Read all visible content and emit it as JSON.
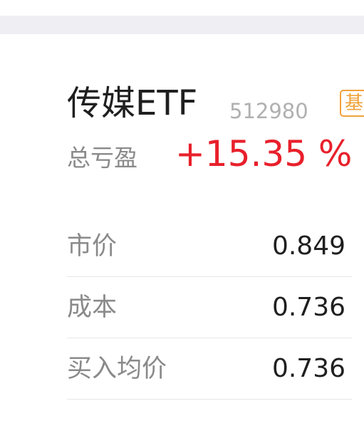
{
  "fund": {
    "name": "传媒ETF",
    "code": "512980",
    "badge": "基"
  },
  "summary": {
    "total_pl_label": "总亏盈",
    "total_pl_value": "+15.35 %"
  },
  "details": [
    {
      "label": "市价",
      "value": "0.849"
    },
    {
      "label": "成本",
      "value": "0.736"
    },
    {
      "label": "买入均价",
      "value": "0.736"
    }
  ],
  "colors": {
    "positive": "#e8202b",
    "badge": "#f0a23b",
    "label_gray": "#8a8a8a",
    "top_band": "#eeeef3"
  }
}
